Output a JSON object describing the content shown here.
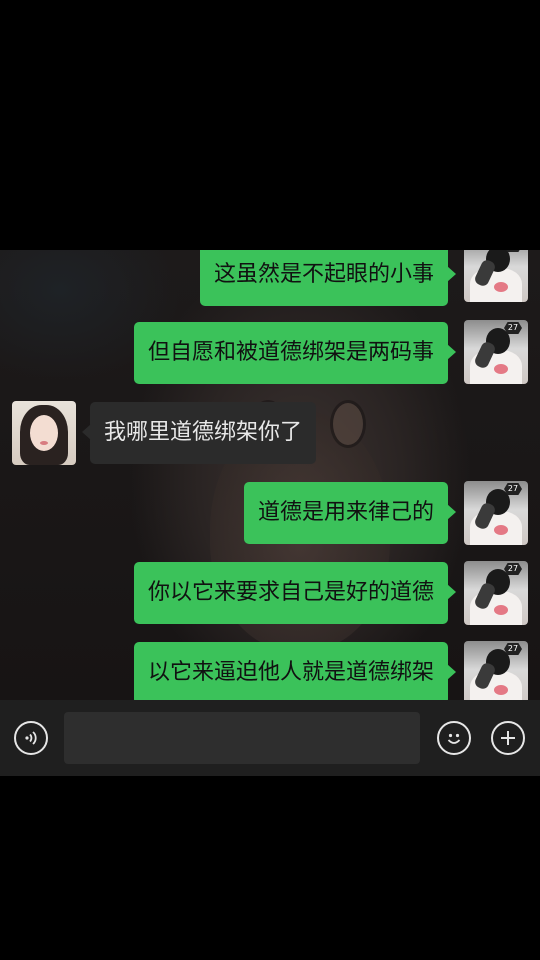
{
  "conversation": {
    "messages": [
      {
        "side": "right",
        "text": "这虽然是不起眼的小事"
      },
      {
        "side": "right",
        "text": "但自愿和被道德绑架是两码事"
      },
      {
        "side": "left",
        "text": "我哪里道德绑架你了"
      },
      {
        "side": "right",
        "text": "道德是用来律己的"
      },
      {
        "side": "right",
        "text": "你以它来要求自己是好的道德"
      },
      {
        "side": "right",
        "text": "以它来逼迫他人就是道德绑架"
      }
    ],
    "my_avatar_badge": "27"
  },
  "input_bar": {
    "voice_icon": "voice-wave-icon",
    "emoji_icon": "smiley-icon",
    "add_icon": "plus-circle-icon",
    "text_value": ""
  },
  "colors": {
    "my_bubble": "#3bc25a",
    "their_bubble": "#2b2b2b",
    "input_bar_bg": "#1f1f1f",
    "page_bg": "#000000"
  }
}
